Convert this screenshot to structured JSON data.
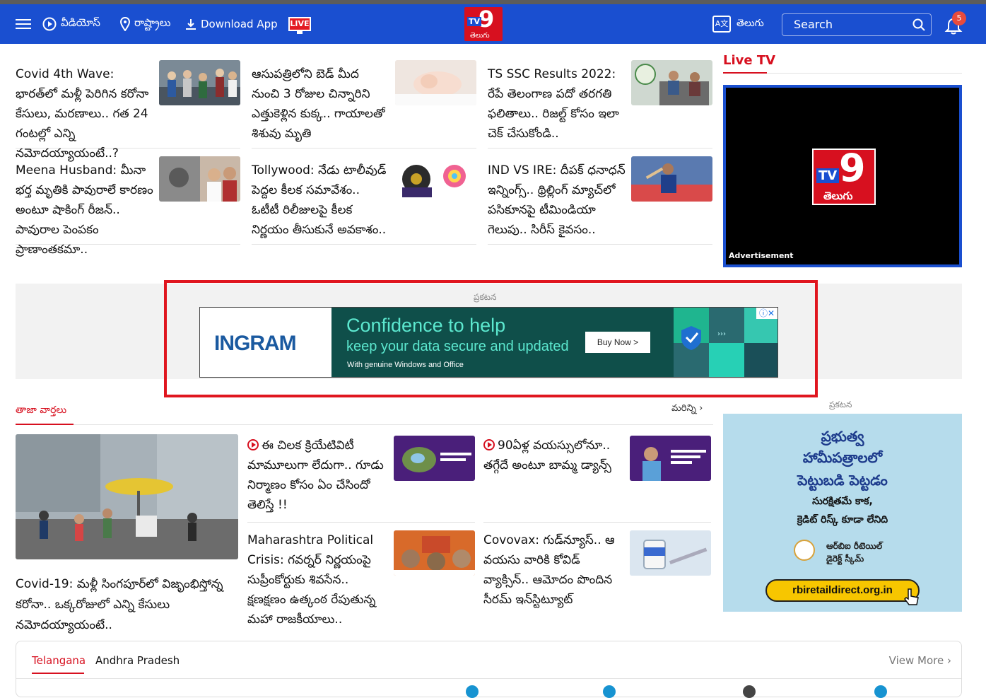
{
  "header": {
    "videos": "వీడియోస్",
    "states": "రాష్ట్రాలు",
    "download": "Download App",
    "live": "LIVE",
    "logo_tv": "TV",
    "logo_nine": "9",
    "logo_lang": "తెలుగు",
    "language": "తెలుగు",
    "search_placeholder": "Search",
    "notif_count": "5"
  },
  "top_stories": [
    {
      "text": "Covid 4th Wave: భారత్‌లో మళ్లీ పెరిగిన కరోనా కేసులు, మరణాలు.. గత 24 గంటల్లో ఎన్ని నమోదయ్యాయంటే..?"
    },
    {
      "text": "ఆసుపత్రిలోని బెడ్ మీద నుంచి 3 రోజుల చిన్నారిని ఎత్తుకెళ్లిన కుక్క.. గాయాలతో శిశువు మృతి"
    },
    {
      "text": "TS SSC Results 2022: రేపే తెలంగాణ పదో తరగతి ఫలితాలు.. రిజల్ట్ కోసం ఇలా చెక్ చేసుకోండి.."
    },
    {
      "text": "Meena Husband: మీనా భర్త మృతికి పావురాలే కారణం అంటూ షాకింగ్ రీజన్.. పావురాల పెంపకం ప్రాణాంతకమా.."
    },
    {
      "text": "Tollywood: నేడు టాలీవుడ్ పెద్దల కీలక సమావేశం.. ఓటీటీ రిలీజులపై కీలక నిర్ణయం తీసుకునే అవకాశం.."
    },
    {
      "text": "IND VS IRE: దీపక్ ధనాధన్ ఇన్నింగ్స్.. థ్రిల్లింగ్ మ్యాచ్‌లో పసికూనపై టీమిండియా గెలుపు.. సిరీస్ కైవసం.."
    }
  ],
  "live_tv": {
    "title": "Live TV",
    "advertisement": "Advertisement"
  },
  "ad": {
    "label": "ప్రకటన",
    "brand": "INGRAM",
    "headline": "Confidence to help",
    "sub": "keep your data secure and updated",
    "small": "With genuine Windows and Office",
    "cta": "Buy Now >"
  },
  "latest": {
    "title": "తాజా వార్తలు",
    "more": "మరిన్ని",
    "main_caption": "Covid-19: మళ్లీ సింగపూర్‌లో విజృంభిస్తోన్న కరోనా.. ఒక్కరోజులో ఎన్ని కేసులు నమోదయ్యాయంటే..",
    "items": [
      {
        "text": "ఈ చిలక క్రియేటివిటీ మామూలుగా లేదుగా.. గూడు నిర్మాణం కోసం ఏం చేసిందో తెలిస్తే !!"
      },
      {
        "text": "90ఏళ్ల వయస్సులోనూ.. తగ్గేదే అంటూ బామ్మ డ్యాన్స్"
      },
      {
        "text": "Maharashtra Political Crisis: గవర్నర్ నిర్ణయంపై సుప్రీంకోర్టుకు శివసేన.. క్షణక్షణం ఉత్కంఠ రేపుతున్న మహా రాజకీయాలు.."
      },
      {
        "text": "Covovax: గుడ్‌న్యూస్.. ఆ వయసు వారికి కోవిడ్ వ్యాక్సిన్.. ఆమోదం పొందిన సీరమ్ ఇన్‌స్టిట్యూట్"
      }
    ]
  },
  "ad2": {
    "label": "ప్రకటన",
    "l1": "ప్రభుత్వ",
    "l2": "హామీపత్రాలలో",
    "l3": "పెట్టుబడి పెట్టడం",
    "l4": "సురక్షితమే కాక,",
    "l5": "క్రెడిట్ రిస్క్ కూడా లేనిది",
    "rbi1": "ఆర్‌బిఐ రీటెయిల్",
    "rbi2": "డైరెక్ట్ స్కీమ్",
    "url": "rbiretaildirect.org.in"
  },
  "regions": {
    "tab1": "Telangana",
    "tab2": "Andhra Pradesh",
    "view_more": "View More"
  },
  "colors": {
    "header_blue": "#1a4fd0",
    "accent_red": "#d7101f"
  }
}
